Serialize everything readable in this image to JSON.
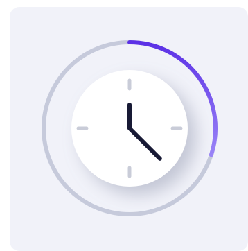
{
  "widget": {
    "icon": "clock-icon",
    "progress_fraction": 0.3,
    "clock_hour_hand_deg": 0,
    "clock_minute_hand_deg": 135
  },
  "colors": {
    "card_background": "#f1f2f9",
    "track": "#c6cadb",
    "progress_start": "#5b30e6",
    "progress_end": "#9a84f7",
    "clock_face": "#ffffff",
    "ticks": "#c9ccd8",
    "hands": "#181a35"
  }
}
